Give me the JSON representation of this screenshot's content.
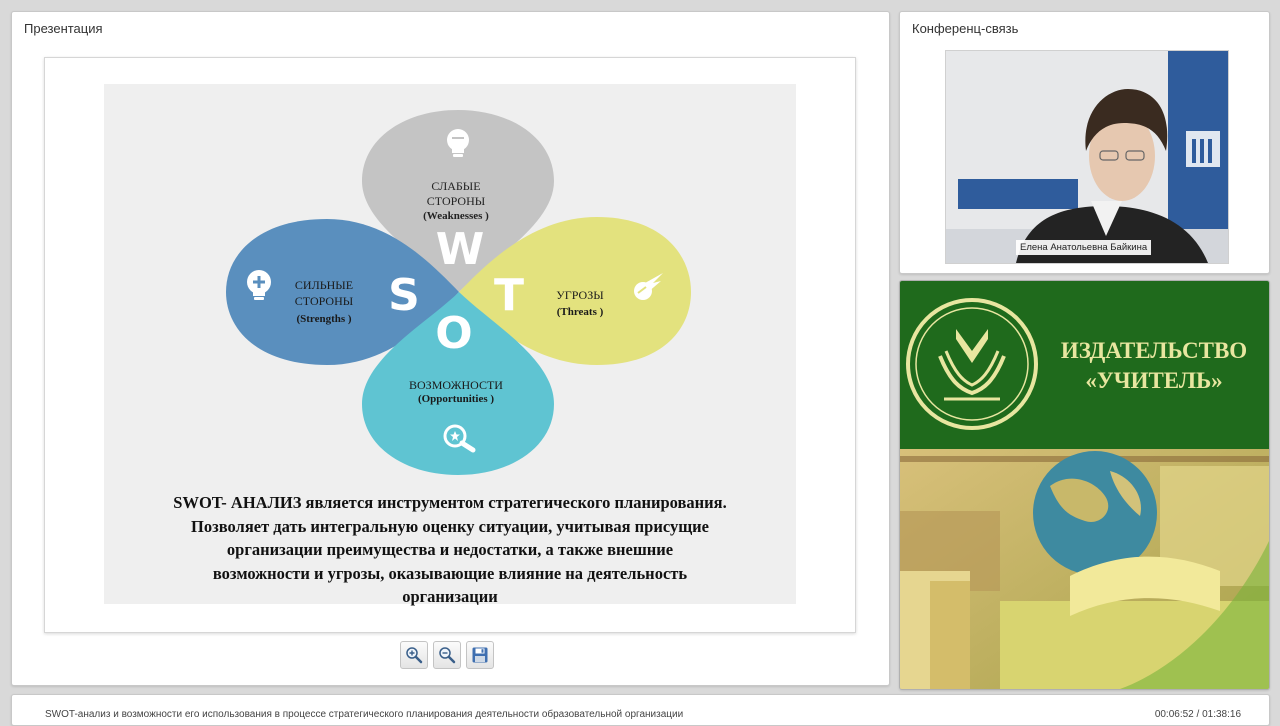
{
  "presentation_panel": {
    "title": "Презентация",
    "slide": {
      "swot_labels": {
        "weaknesses": {
          "line1": "СЛАБЫЕ",
          "line2": "СТОРОНЫ",
          "line3": "(Weaknesses )",
          "letter": "W"
        },
        "strengths": {
          "line1": "СИЛЬНЫЕ",
          "line2": "СТОРОНЫ",
          "line3": "(Strengths )",
          "letter": "S"
        },
        "threats": {
          "line1": "УГРОЗЫ",
          "line2": "(Threats )",
          "letter": "T"
        },
        "opportunities": {
          "line1": "ВОЗМОЖНОСТИ",
          "line2": "(Opportunities )",
          "letter": "O"
        }
      },
      "petal_colors": {
        "weaknesses": "#c4c4c4",
        "strengths": "#5a8fbe",
        "threats": "#e3e27e",
        "opportunities": "#5fc4d2"
      },
      "text_lines": [
        "SWOT- АНАЛИЗ является инструментом стратегического планирования.",
        "Позволяет дать интегральную оценку ситуации, учитывая присущие",
        "организации преимущества и недостатки, а также внешние",
        "возможности и угрозы, оказывающие влияние на деятельность",
        "организации"
      ]
    },
    "toolbar": {
      "zoom_in": "zoom-in-icon",
      "zoom_out": "zoom-out-icon",
      "save": "save-icon"
    }
  },
  "conference_panel": {
    "title": "Конференц-связь",
    "speaker_name": "Елена Анатольевна Байкина"
  },
  "promo_panel": {
    "publisher_line1": "ИЗДАТЕЛЬСТВО",
    "publisher_line2": "«УЧИТЕЛЬ»",
    "brand_color": "#1f6a1c",
    "accent_color": "#e8e6a0"
  },
  "footer": {
    "webinar_title": "SWOT-анализ и возможности его использования в процессе стратегического планирования деятельности образовательной организации",
    "time": "00:06:52 / 01:38:16"
  }
}
